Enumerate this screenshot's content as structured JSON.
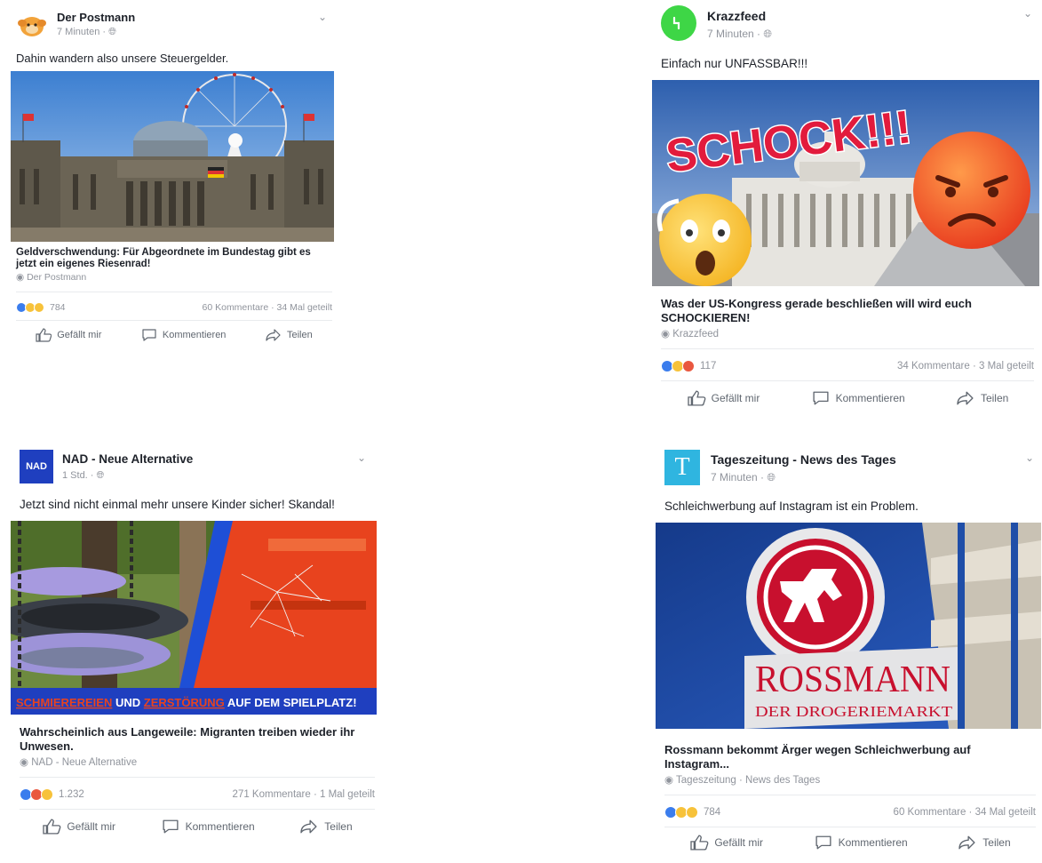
{
  "posts": [
    {
      "author": "Der Postmann",
      "meta": "7 Minuten · ",
      "text": "Dahin wandern also unsere Steuergelder.",
      "link_title": "Geldverschwendung: Für Abgeordnete im Bundestag gibt es jetzt ein eigenes Riesenrad!",
      "link_source": "Der Postmann",
      "reaction_count": "784",
      "stats": "60 Kommentare · 34 Mal geteilt",
      "like": "Gefällt mir",
      "comment": "Kommentieren",
      "share": "Teilen"
    },
    {
      "author": "Krazzfeed",
      "meta": "7 Minuten · ",
      "text": "Einfach nur UNFASSBAR!!!",
      "image_caption": "SCHOCK!!!",
      "link_title": "Was der US-Kongress gerade beschließen will wird euch SCHOCKIEREN!",
      "link_source": "Krazzfeed",
      "reaction_count": "117",
      "stats": "34 Kommentare · 3 Mal geteilt",
      "like": "Gefällt mir",
      "comment": "Kommentieren",
      "share": "Teilen"
    },
    {
      "author": "NAD - Neue Alternative",
      "meta": "1 Std. · ",
      "avatar_text": "NAD",
      "text": "Jetzt sind nicht einmal mehr unsere Kinder sicher! Skandal!",
      "banner_word1": "SCHMIEREREIEN",
      "banner_word2": " UND ",
      "banner_word3": "ZERSTÖRUNG",
      "banner_word4": " AUF DEM SPIELPLATZ!",
      "link_title": "Wahrscheinlich aus Langeweile: Migranten treiben wieder ihr Unwesen.",
      "link_source": "NAD - Neue Alternative",
      "reaction_count": "1.232",
      "stats": "271 Kommentare · 1 Mal geteilt",
      "like": "Gefällt mir",
      "comment": "Kommentieren",
      "share": "Teilen"
    },
    {
      "author": "Tageszeitung - News des Tages",
      "meta": "7 Minuten · ",
      "avatar_text": "T",
      "text": "Schleichwerbung auf Instagram ist ein Problem.",
      "sign_brand": "ROSSMANN",
      "sign_sub": "DER DROGERIEMARKT",
      "link_title": "Rossmann bekommt Ärger wegen Schleichwerbung auf Instagram...",
      "link_source": "Tageszeitung · News des Tages",
      "reaction_count": "784",
      "stats": "60 Kommentare · 34 Mal geteilt",
      "like": "Gefällt mir",
      "comment": "Kommentieren",
      "share": "Teilen"
    }
  ],
  "colors": {
    "like_blue": "#3b7ded",
    "haha_yellow": "#f7c23a",
    "angry_red": "#e9573f",
    "krazz_green": "#3ed646",
    "nad_blue": "#1f3fbf",
    "tageszeitung_teal": "#2fb5e0",
    "rossmann_red": "#c8102e"
  },
  "icons": [
    "globe-icon",
    "chevron-down-icon",
    "like-icon",
    "comment-icon",
    "share-icon"
  ]
}
